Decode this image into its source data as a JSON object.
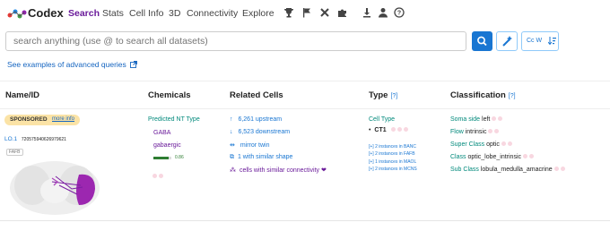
{
  "nav": {
    "brand": "Codex",
    "links": [
      "Search",
      "Stats",
      "Cell Info",
      "3D",
      "Connectivity",
      "Explore"
    ],
    "icons": [
      "trophy-icon",
      "flag-icon",
      "tools-icon",
      "puzzle-icon",
      "download-icon",
      "account-icon",
      "help-icon"
    ]
  },
  "search": {
    "placeholder": "search anything (use @ to search all datasets)",
    "case_label": "Cc W",
    "advanced_link": "See examples of advanced queries"
  },
  "headers": {
    "name_id": "Name/ID",
    "chemicals": "Chemicals",
    "related": "Related Cells",
    "type": "Type",
    "type_q": "[?]",
    "classification": "Classification",
    "class_q": "[?]"
  },
  "row": {
    "sponsored": "SPONSORED",
    "more_info": "more info",
    "name": "LO.1",
    "id": "720575940626979621",
    "tag": "FAFB",
    "chem": {
      "predicted": "Predicted NT Type",
      "gaba": "GABA",
      "gabaergic": "gabaergic",
      "confidence": "0.86",
      "confidence_level": 0.86
    },
    "related": {
      "upstream": "6,261 upstream",
      "downstream": "6,523 downstream",
      "mirror": "mirror twin",
      "similar_shape": "1 with similar shape",
      "similar_conn": "cells with similar connectivity ❤"
    },
    "type": {
      "label": "Cell Type",
      "value": "CT1",
      "instances": [
        "[+] 2 instances in BANC",
        "[+] 2 instances in FAFB",
        "[+] 1 instances in MAOL",
        "[+] 2 instances in MCNS"
      ]
    },
    "classification": [
      {
        "key": "Soma side",
        "value": "left"
      },
      {
        "key": "Flow",
        "value": "intrinsic"
      },
      {
        "key": "Super Class",
        "value": "optic"
      },
      {
        "key": "Class",
        "value": "optic_lobe_intrinsic"
      },
      {
        "key": "Sub Class",
        "value": "lobula_medulla_amacrine"
      }
    ]
  },
  "colors": {
    "accent": "#6a1b9a",
    "link": "#1976d2",
    "primary_button": "#1976d2",
    "sponsored_bg": "#fbe3a6",
    "highlight_neuron": "#8e24aa"
  }
}
